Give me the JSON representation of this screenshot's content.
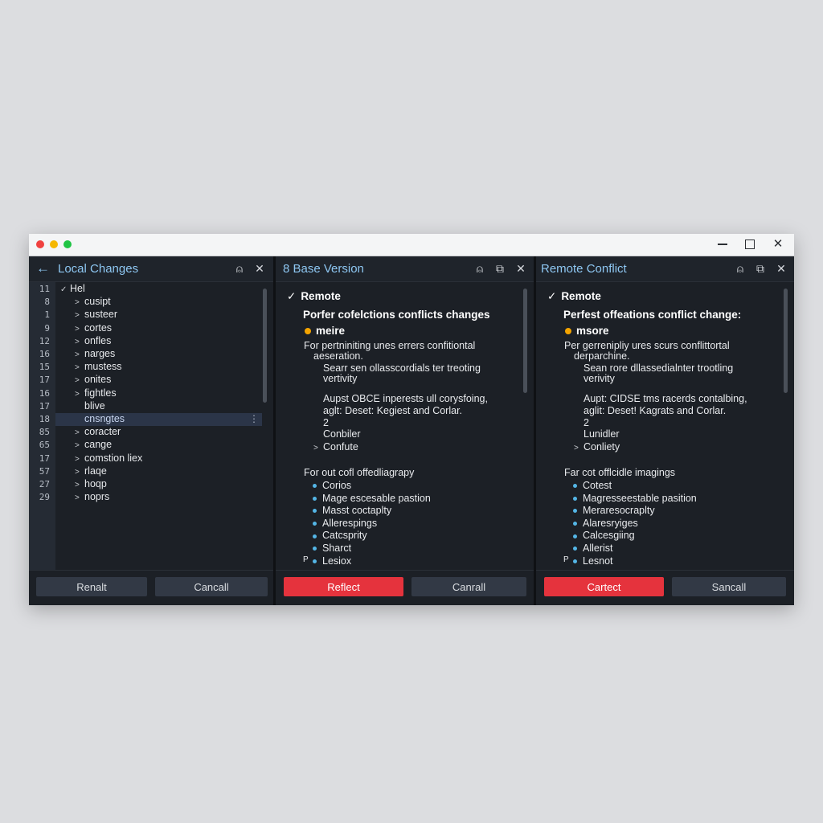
{
  "colors": {
    "accent": "#8ec7f2",
    "danger": "#e5333d",
    "bullet": "#54b6e6",
    "marker": "#f4a400"
  },
  "local": {
    "title": "Local Changes",
    "line_numbers": [
      "11",
      "8",
      "1",
      "9",
      "12",
      "16",
      "15",
      "17",
      "16",
      "17",
      "18",
      "85",
      "65",
      "17",
      "57",
      "27",
      "29"
    ],
    "tree": [
      {
        "label": "Hel",
        "chevron": "✓"
      },
      {
        "label": "cusipt",
        "chevron": ">"
      },
      {
        "label": "susteer",
        "chevron": ">"
      },
      {
        "label": "cortes",
        "chevron": ">"
      },
      {
        "label": "onfles",
        "chevron": ">"
      },
      {
        "label": "narges",
        "chevron": ">"
      },
      {
        "label": "mustess",
        "chevron": ">"
      },
      {
        "label": "onites",
        "chevron": ">"
      },
      {
        "label": "fightles",
        "chevron": ">"
      },
      {
        "label": "blive",
        "chevron": ""
      },
      {
        "label": "cnsngtes",
        "chevron": ""
      },
      {
        "label": "coracter",
        "chevron": ">"
      },
      {
        "label": "cange",
        "chevron": ">"
      },
      {
        "label": "comstion liex",
        "chevron": ">"
      },
      {
        "label": "rlaqe",
        "chevron": ">"
      },
      {
        "label": "hoqp",
        "chevron": ">"
      },
      {
        "label": "noprѕ",
        "chevron": ">"
      }
    ],
    "buttons": {
      "primary": "Renalt",
      "secondary": "Cancall"
    }
  },
  "base": {
    "title": "8 Base Version",
    "heading": "Remote",
    "subheading": "Porfer cofelctions conflicts changes",
    "marker_label": "meire",
    "para1": "For pertniniting unes errers confitiontal",
    "para1b": "aeseration.",
    "para2": "Searr sen ollasscordials ter treoting",
    "para2b": "vertivity",
    "para3": "Aupst OBCE inperests ull corysfoing,",
    "para3b": "aglt: Deset: Kegiest and Corlar.",
    "num": "2",
    "item_a": "Conbiler",
    "item_b": "Confute",
    "list_heading": "For out cofl offedliagrapy",
    "bullets": [
      "Corios",
      "Mage escesable pastion",
      "Masst coctaplty",
      "Allerespings",
      "Catcsprity",
      "Sharct",
      "Lesiox"
    ],
    "last_prefix": "P",
    "buttons": {
      "primary": "Reflect",
      "secondary": "Canrall"
    }
  },
  "remote": {
    "title": "Remote Conflict",
    "heading": "Remote",
    "subheading": "Perfest offeations conflict change:",
    "marker_label": "msore",
    "para1": "Per gerrenipliy ures scurs conflittortal",
    "para1b": "derparchine.",
    "para2": "Sean rore dllassedialnter trootling",
    "para2b": "verivity",
    "para3": "Aupt: CIDSE tms racerds contalbing,",
    "para3b": "aglit: Deset! Kagrats and Corlar.",
    "num": "2",
    "item_a": "Lunidler",
    "item_b": "Conliety",
    "list_heading": "Far cot offlcidle imagings",
    "bullets": [
      "Cotest",
      "Magresseestable pasition",
      "Meraresocraplty",
      "Alaresryiges",
      "Calcesgiing",
      "Allerist",
      "Lesnot"
    ],
    "last_prefix": "P",
    "buttons": {
      "primary": "Cartect",
      "secondary": "Sancall"
    }
  }
}
